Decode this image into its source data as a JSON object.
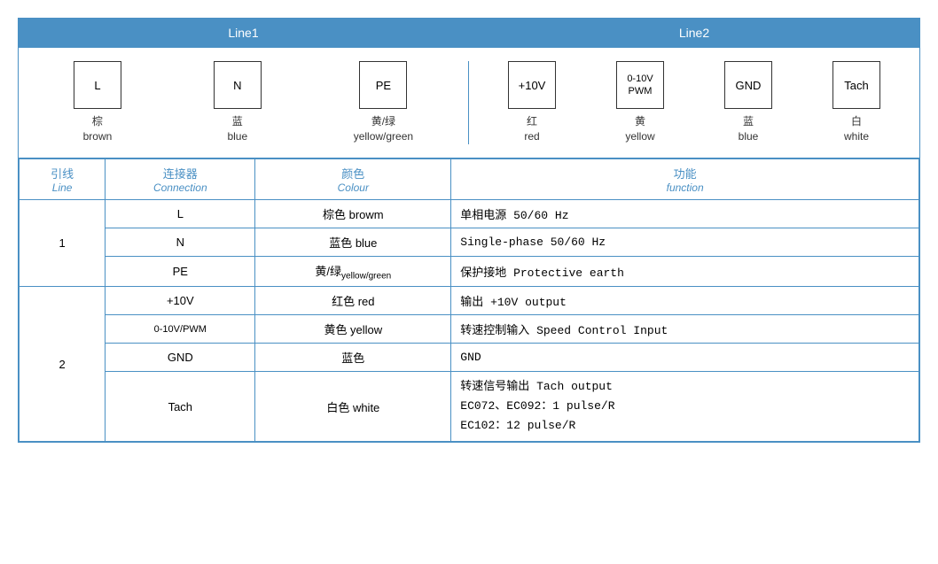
{
  "header": {
    "line1": "Line1",
    "line2": "Line2"
  },
  "diagram": {
    "line1_items": [
      {
        "label": "L",
        "zh": "棕",
        "en": "brown",
        "type": "normal"
      },
      {
        "label": "N",
        "zh": "蓝",
        "en": "blue",
        "type": "normal"
      },
      {
        "label": "PE",
        "zh": "黄/绿",
        "en": "yellow/green",
        "type": "normal"
      }
    ],
    "line2_items": [
      {
        "label": "+10V",
        "zh": "红",
        "en": "red",
        "type": "normal"
      },
      {
        "label": "0-10V\nPWM",
        "zh": "黄",
        "en": "yellow",
        "type": "small"
      },
      {
        "label": "GND",
        "zh": "蓝",
        "en": "blue",
        "type": "normal"
      },
      {
        "label": "Tach",
        "zh": "白",
        "en": "white",
        "type": "normal"
      }
    ]
  },
  "table": {
    "headers": [
      {
        "zh": "引线",
        "en": "Line"
      },
      {
        "zh": "连接器",
        "en": "Connection"
      },
      {
        "zh": "颜色",
        "en": "Colour"
      },
      {
        "zh": "功能",
        "en": "function"
      }
    ],
    "rows": [
      {
        "line": "1",
        "rowspan": 3,
        "entries": [
          {
            "conn": "L",
            "colour_zh": "棕色",
            "colour_en": "browm",
            "func": "单相电源 50/60 Hz",
            "func_sub": ""
          },
          {
            "conn": "N",
            "colour_zh": "蓝色",
            "colour_en": "blue",
            "func": "Single-phase 50/60 Hz",
            "func_sub": ""
          },
          {
            "conn": "PE",
            "colour_zh": "黄/绿",
            "colour_en": "yellow/green",
            "func": "保护接地 Protective earth",
            "func_sub": ""
          }
        ]
      },
      {
        "line": "2",
        "rowspan": 4,
        "entries": [
          {
            "conn": "+10V",
            "colour_zh": "红色",
            "colour_en": "red",
            "func": "输出 +10V output",
            "func_sub": ""
          },
          {
            "conn": "0-10V/PWM",
            "colour_zh": "黄色",
            "colour_en": "yellow",
            "func": "转速控制输入 Speed Control Input",
            "func_sub": ""
          },
          {
            "conn": "GND",
            "colour_zh": "蓝色",
            "colour_en": "",
            "func": "GND",
            "func_sub": ""
          },
          {
            "conn": "Tach",
            "colour_zh": "白色",
            "colour_en": "white",
            "func": "转速信号输出 Tach output\nEC072、EC092：1 pulse/R\nEC102：12 pulse/R",
            "func_sub": ""
          }
        ]
      }
    ]
  }
}
